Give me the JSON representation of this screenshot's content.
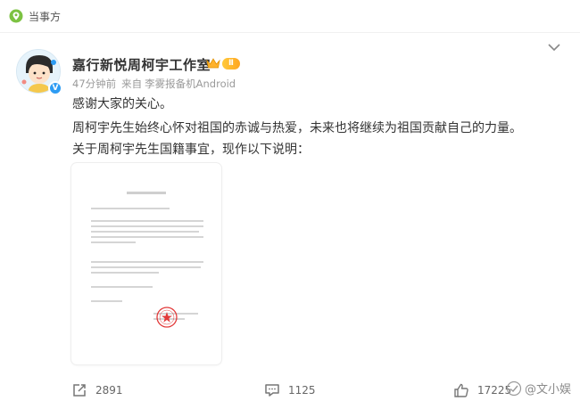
{
  "top_bar": {
    "label": "当事方"
  },
  "post": {
    "author": "嘉行新悦周柯宇工作室",
    "vip_level": "Ⅱ",
    "verified_mark": "V",
    "time": "47分钟前",
    "source_prefix": "来自",
    "source": "李雾报备机Android",
    "lines": [
      "感谢大家的关心。",
      "周柯宇先生始终心怀对祖国的赤诚与热爱，未来也将继续为祖国贡献自己的力量。",
      "关于周柯宇先生国籍事宜，现作以下说明："
    ]
  },
  "actions": {
    "repost_count": "2891",
    "comment_count": "1125",
    "like_count": "17225"
  },
  "watermark": {
    "text": "@文小娱"
  },
  "colors": {
    "accent": "#2d9cf3",
    "vip": "#ffb22c",
    "seal": "#e23a3a",
    "location_icon": "#7cc242"
  },
  "icons": {
    "location": "location-icon",
    "chevron": "chevron-down-icon",
    "repost": "repost-icon",
    "comment": "comment-icon",
    "like": "like-icon",
    "watermark": "watermark-icon"
  }
}
